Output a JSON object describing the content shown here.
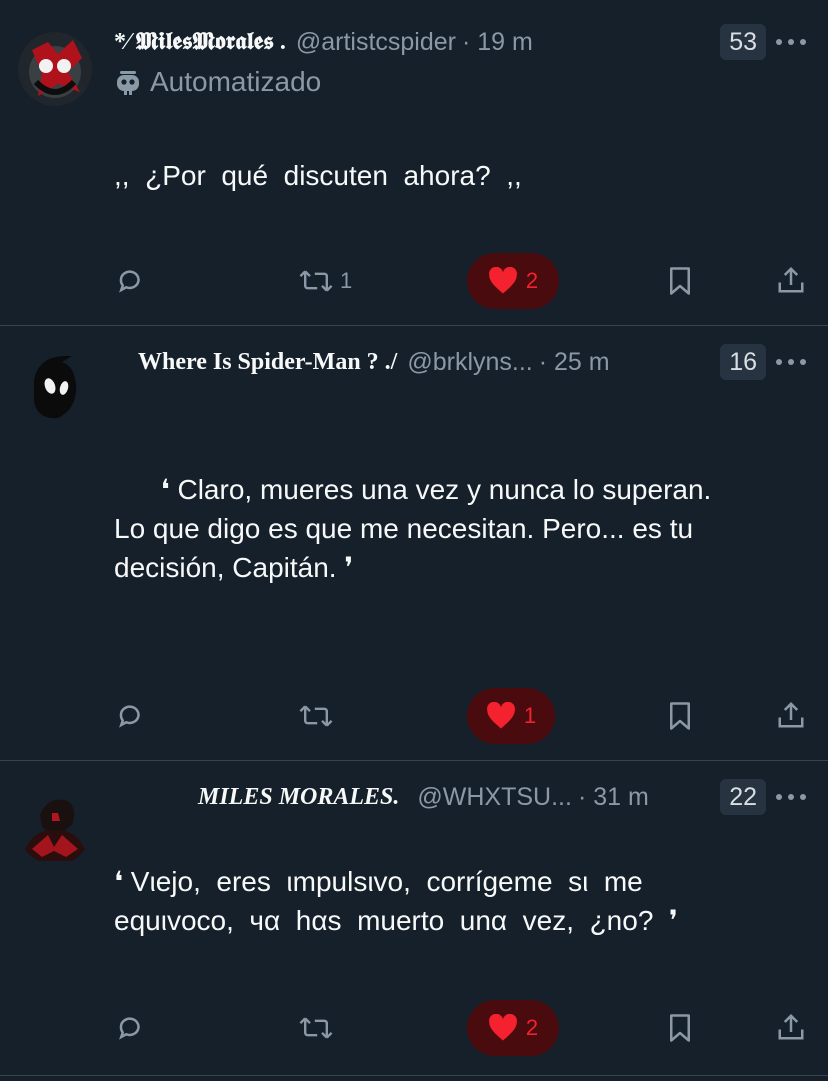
{
  "tweets": [
    {
      "display_name": "*⁄ 𝕸𝖎𝖑𝖊𝖘𝕸𝖔𝖗𝖆𝖑𝖊𝖘 .",
      "handle": "@artistcspider",
      "time": "· 19 m",
      "badge_count": "53",
      "automated_label": "Automatizado",
      "text": ",,  ¿Por  qué  discuten  ahora?  ,,",
      "retweet_count": "1",
      "like_count": "2"
    },
    {
      "display_name": "Where Is Spider-Man ? ./",
      "handle": "@brklyns...",
      "time": "· 25 m",
      "badge_count": "16",
      "text_lines": [
        "      ❛ Claro, mueres una vez y nunca lo superan.",
        "Lo que digo es que me necesitan. Pero... es tu",
        "decisión, Capitán. ❜"
      ],
      "retweet_count": "",
      "like_count": "1"
    },
    {
      "display_name": "MILES MORALES.",
      "handle": "@WHXTSU...",
      "time": "· 31 m",
      "badge_count": "22",
      "text_lines": [
        "❛ Vιejo,  eres  ιmpulsιvo,  corrígeme  sι  me",
        "equιvoco,  чα  hαs  muerto  unα  vez,  ¿no?  ❜"
      ],
      "retweet_count": "",
      "like_count": "2"
    }
  ],
  "icons": {
    "reply": "reply-icon",
    "retweet": "retweet-icon",
    "like": "heart-icon",
    "bookmark": "bookmark-icon",
    "share": "share-icon",
    "more": "more-icon",
    "automated": "robot-icon"
  },
  "colors": {
    "background": "#15202b",
    "secondary_text": "#8b98a5",
    "like_red": "#f4212e",
    "like_pill": "#4a0b0f"
  }
}
